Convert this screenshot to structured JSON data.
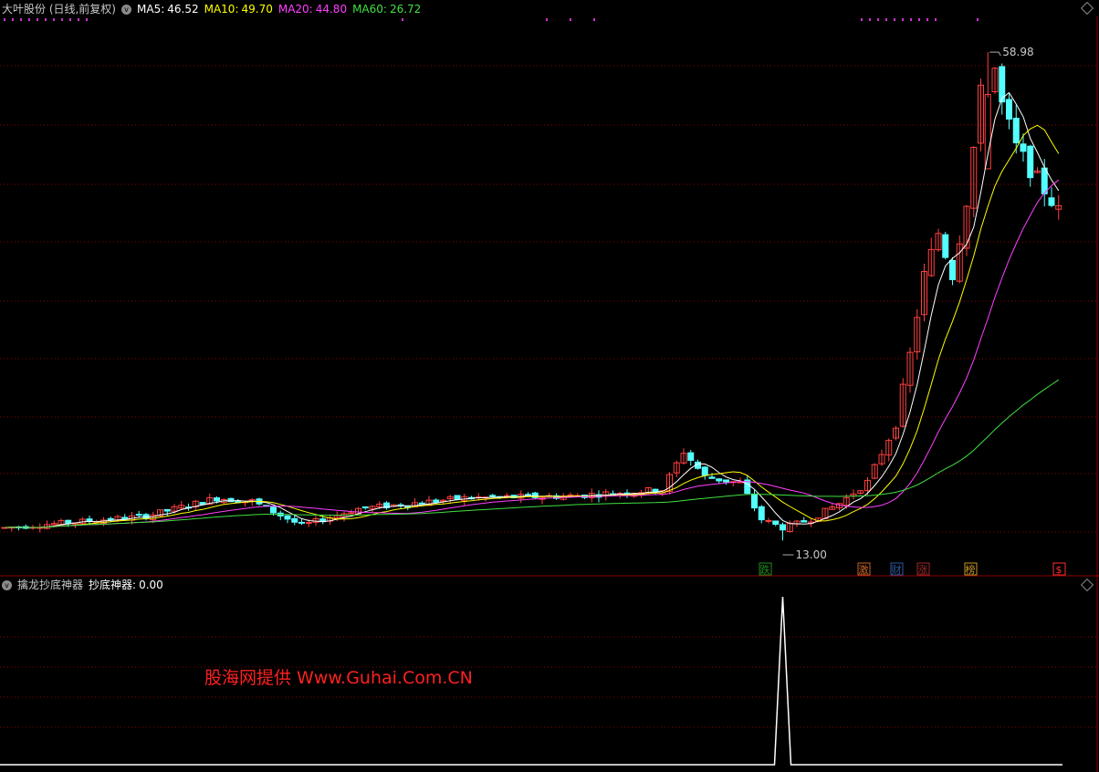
{
  "main_header": {
    "title": "大叶股份 (日线,前复权)",
    "ma5_label": "MA5:",
    "ma5_value": "46.52",
    "ma10_label": "MA10:",
    "ma10_value": "49.70",
    "ma20_label": "MA20:",
    "ma20_value": "44.80",
    "ma60_label": "MA60:",
    "ma60_value": "26.72"
  },
  "sub_header": {
    "title": "擒龙抄底神器",
    "series_label": "抄底神器:",
    "series_value": "0.00"
  },
  "annotations": {
    "high_label": "58.98",
    "low_label": "13.00"
  },
  "event_markers": [
    {
      "text": "跌",
      "color": "#1e8c1e"
    },
    {
      "text": "激",
      "color": "#c86428"
    },
    {
      "text": "财",
      "color": "#2c5aa0"
    },
    {
      "text": "涨",
      "color": "#a02828"
    },
    {
      "text": "榜",
      "color": "#c89628"
    },
    {
      "text": "$",
      "color": "#ff3030"
    }
  ],
  "watermark": "股海网提供 Www.Guhai.Com.CN",
  "colors": {
    "up": "#ff4040",
    "down": "#54ffff",
    "ma5": "#ffffff",
    "ma10": "#ffff00",
    "ma20": "#ff40ff",
    "ma60": "#40e040",
    "grid": "#8b0000",
    "signal": "#ffffff",
    "dots": "#cc33cc"
  },
  "chart_data": {
    "type": "candlestick",
    "price_range": [
      12,
      62
    ],
    "high": 58.98,
    "low": 13.0,
    "indicator_peak": 1,
    "indicator_current": 0.0
  }
}
